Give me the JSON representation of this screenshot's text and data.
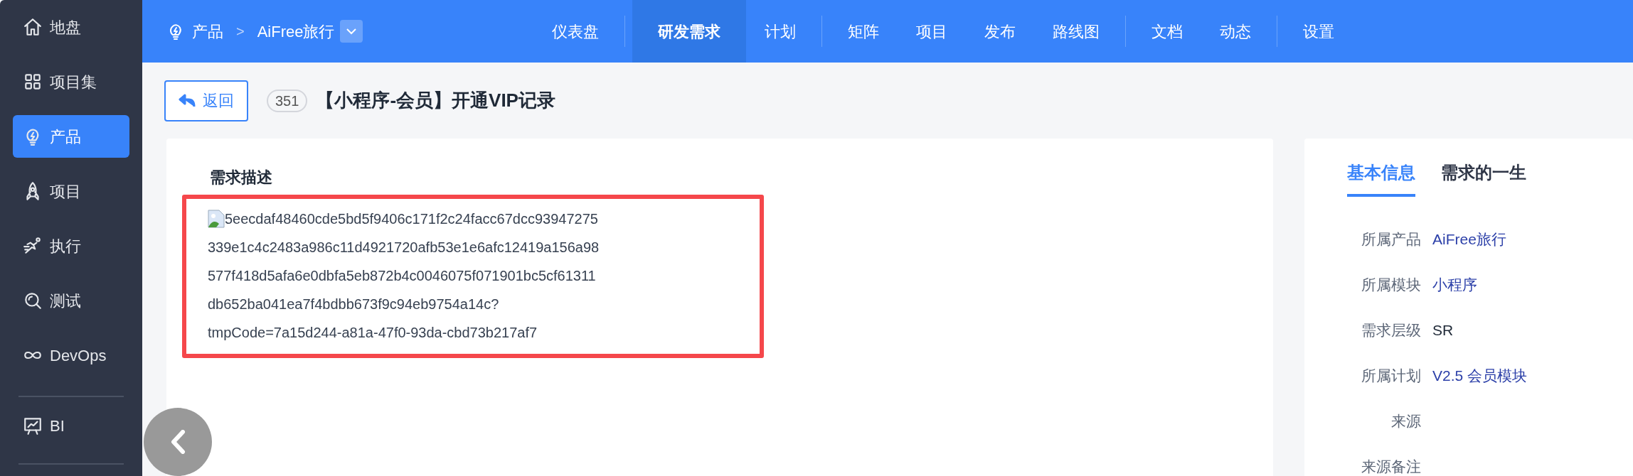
{
  "sidebar": {
    "items": [
      {
        "label": "地盘",
        "kind": "home",
        "selected": false
      },
      {
        "label": "项目集",
        "kind": "grid",
        "selected": false
      },
      {
        "label": "产品",
        "kind": "bulb",
        "selected": true
      },
      {
        "label": "项目",
        "kind": "rocket",
        "selected": false
      },
      {
        "label": "执行",
        "kind": "run",
        "selected": false
      },
      {
        "label": "测试",
        "kind": "search",
        "selected": false
      },
      {
        "label": "DevOps",
        "kind": "infinity",
        "selected": false
      },
      {
        "label": "BI",
        "kind": "chart",
        "selected": false,
        "divider_before": true
      }
    ]
  },
  "breadcrumb": {
    "section": "产品",
    "separator": ">",
    "product": "AiFree旅行"
  },
  "nav_groups": [
    [
      {
        "label": "仪表盘",
        "selected": false
      }
    ],
    [
      {
        "label": "研发需求",
        "selected": true
      },
      {
        "label": "计划",
        "selected": false
      }
    ],
    [
      {
        "label": "矩阵",
        "selected": false
      },
      {
        "label": "项目",
        "selected": false
      },
      {
        "label": "发布",
        "selected": false
      },
      {
        "label": "路线图",
        "selected": false
      }
    ],
    [
      {
        "label": "文档",
        "selected": false
      },
      {
        "label": "动态",
        "selected": false
      }
    ],
    [
      {
        "label": "设置",
        "selected": false
      }
    ]
  ],
  "header": {
    "back": "返回",
    "id": "351",
    "title": "【小程序-会员】开通VIP记录"
  },
  "description": {
    "heading": "需求描述",
    "lines": [
      "5eecdaf48460cde5bd5f9406c171f2c24facc67dcc93947275",
      "339e1c4c2483a986c11d4921720afb53e1e6afc12419a156a98",
      "577f418d5afa6e0dbfa5eb872b4c0046075f071901bc5cf61311",
      "db652ba041ea7f4bdbb673f9c94eb9754a14c?",
      "tmpCode=7a15d244-a81a-47f0-93da-cbd73b217af7"
    ]
  },
  "side_tabs": [
    {
      "label": "基本信息",
      "selected": true
    },
    {
      "label": "需求的一生",
      "selected": false
    }
  ],
  "fields": [
    {
      "label": "所属产品",
      "value": "AiFree旅行",
      "kind": "link"
    },
    {
      "label": "所属模块",
      "value": "小程序",
      "kind": "link"
    },
    {
      "label": "需求层级",
      "value": "SR",
      "kind": "text"
    },
    {
      "label": "所属计划",
      "value": "V2.5 会员模块",
      "kind": "link"
    },
    {
      "label": "来源",
      "kind": "empty"
    },
    {
      "label": "来源备注",
      "kind": "empty"
    }
  ]
}
